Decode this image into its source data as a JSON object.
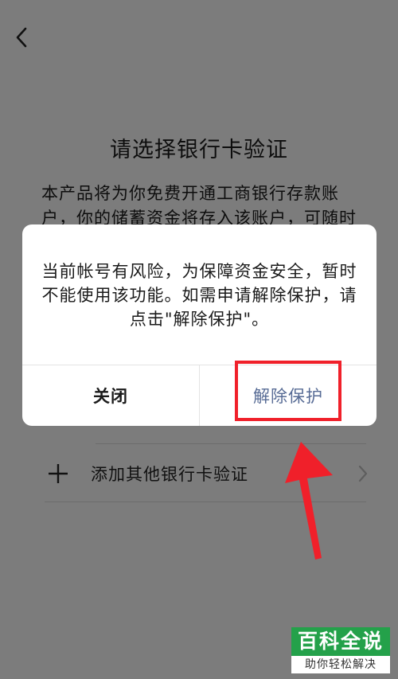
{
  "page": {
    "title": "请选择银行卡验证",
    "description": "本产品将为你免费开通工商银行存款账户，你的储蓄资金将存入该账户，可随时",
    "add_card_label": "添加其他银行卡验证"
  },
  "icons": {
    "back": "back-chevron-icon",
    "plus": "plus-icon",
    "chevron": "chevron-right-icon"
  },
  "dialog": {
    "message": "当前帐号有风险，为保障资金安全，暂时不能使用该功能。如需申请解除保护，请点击\"解除保护\"。",
    "close_label": "关闭",
    "unlock_label": "解除保护"
  },
  "watermark": {
    "top": "百科全说",
    "bottom": "助你轻松解决"
  },
  "colors": {
    "link": "#576b95",
    "annotation": "#f0202a",
    "watermark_green": "#24a14a"
  }
}
